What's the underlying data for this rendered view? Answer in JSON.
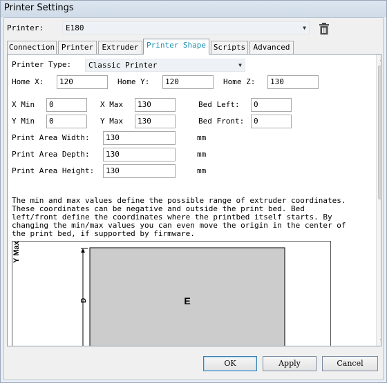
{
  "window": {
    "title": "Printer Settings"
  },
  "printer": {
    "label": "Printer:",
    "value": "E180"
  },
  "tabs": [
    {
      "label": "Connection"
    },
    {
      "label": "Printer"
    },
    {
      "label": "Extruder"
    },
    {
      "label": "Printer Shape",
      "active": true
    },
    {
      "label": "Scripts"
    },
    {
      "label": "Advanced"
    }
  ],
  "shape": {
    "printer_type_label": "Printer Type:",
    "printer_type_value": "Classic Printer",
    "home_x_label": "Home X:",
    "home_x": "120",
    "home_y_label": "Home Y:",
    "home_y": "120",
    "home_z_label": "Home Z:",
    "home_z": "130",
    "x_min_label": "X Min",
    "x_min": "0",
    "x_max_label": "X Max",
    "x_max": "130",
    "bed_left_label": "Bed Left:",
    "bed_left": "0",
    "y_min_label": "Y Min",
    "y_min": "0",
    "y_max_label": "Y Max",
    "y_max": "130",
    "bed_front_label": "Bed Front:",
    "bed_front": "0",
    "width_label": "Print Area Width:",
    "width": "130",
    "width_unit": "mm",
    "depth_label": "Print Area Depth:",
    "depth": "130",
    "depth_unit": "mm",
    "height_label": "Print Area Height:",
    "height": "130",
    "height_unit": "mm",
    "description": "The min and max values define the possible range of extruder coordinates.\nThese coordinates can be negative and outside the print bed. Bed\nleft/front define the coordinates where the printbed itself starts. By\nchanging the min/max values you can even move the origin in the center of\nthe print bed, if supported by firmware."
  },
  "diagram": {
    "y_axis_label": "Y Max",
    "depth_label": "D",
    "bed_label": "E"
  },
  "buttons": {
    "ok": "OK",
    "apply": "Apply",
    "cancel": "Cancel"
  },
  "colors": {
    "active_tab_text": "#1a8fb3",
    "bed_fill": "#cccccc"
  }
}
